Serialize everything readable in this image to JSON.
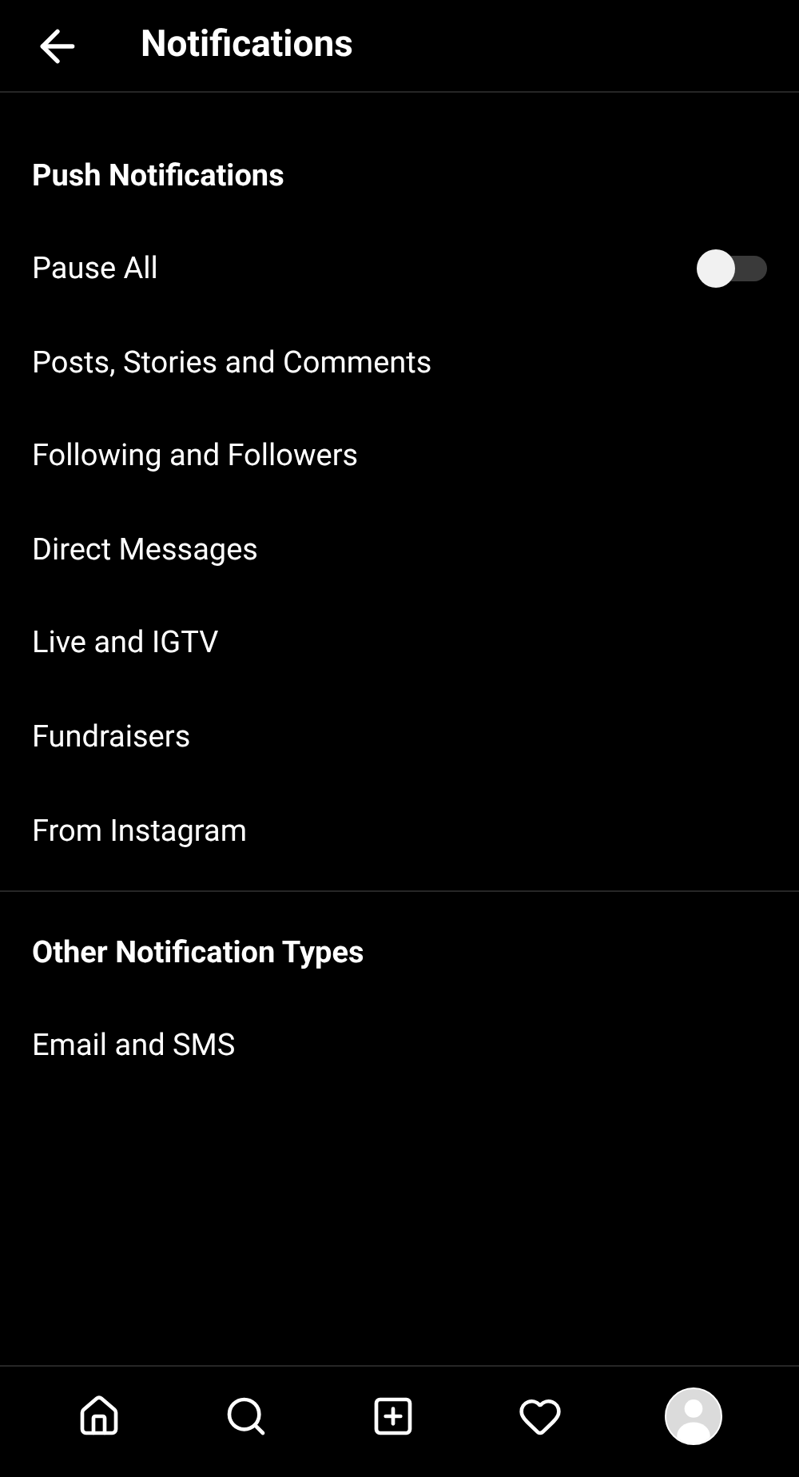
{
  "header": {
    "title": "Notifications"
  },
  "sections": [
    {
      "heading": "Push Notifications",
      "items": [
        {
          "label": "Pause All",
          "kind": "toggle",
          "on": false
        },
        {
          "label": "Posts, Stories and Comments",
          "kind": "link"
        },
        {
          "label": "Following and Followers",
          "kind": "link"
        },
        {
          "label": "Direct Messages",
          "kind": "link"
        },
        {
          "label": "Live and IGTV",
          "kind": "link"
        },
        {
          "label": "Fundraisers",
          "kind": "link"
        },
        {
          "label": "From Instagram",
          "kind": "link"
        }
      ]
    },
    {
      "heading": "Other Notification Types",
      "items": [
        {
          "label": "Email and SMS",
          "kind": "link"
        }
      ]
    }
  ],
  "bottom_nav": [
    {
      "kind": "home"
    },
    {
      "kind": "search"
    },
    {
      "kind": "add"
    },
    {
      "kind": "activity"
    },
    {
      "kind": "profile"
    }
  ]
}
